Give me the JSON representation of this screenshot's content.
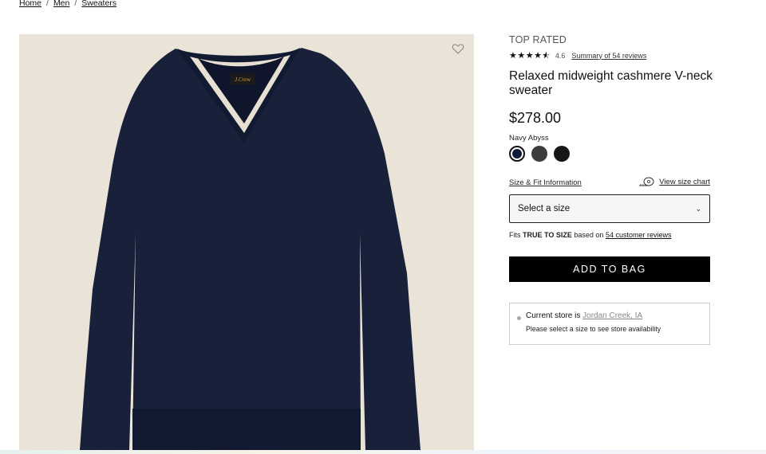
{
  "breadcrumb": {
    "items": [
      "Home",
      "Men",
      "Sweaters"
    ],
    "separator": "/"
  },
  "product": {
    "badge": "TOP RATED",
    "rating": "4.6",
    "stars_filled": 4.5,
    "reviews_link": "Summary of 54 reviews",
    "title": "Relaxed midweight cashmere V-neck sweater",
    "price": "$278.00",
    "color_name": "Navy Abyss",
    "swatches": [
      {
        "name": "Navy Abyss",
        "color": "#101a3a",
        "selected": true
      },
      {
        "name": "Charcoal",
        "color": "#3d3d3d",
        "selected": false
      },
      {
        "name": "Black",
        "color": "#161616",
        "selected": false
      }
    ],
    "label_text": "J.Crew",
    "image_bg": "#e9e3d8",
    "sweater_color": "#18203a"
  },
  "size": {
    "fit_link": "Size & Fit Information",
    "size_chart_link": "View size chart",
    "select_placeholder": "Select a size"
  },
  "fit_note": {
    "prefix": "Fits",
    "emphasis": "TRUE TO SIZE",
    "middle": "based on",
    "link": "54 customer reviews"
  },
  "add_to_bag": "ADD TO BAG",
  "store": {
    "prefix": "Current store is",
    "store_name": "Jordan Creek, IA",
    "availability": "Please select a size to see store availability"
  }
}
